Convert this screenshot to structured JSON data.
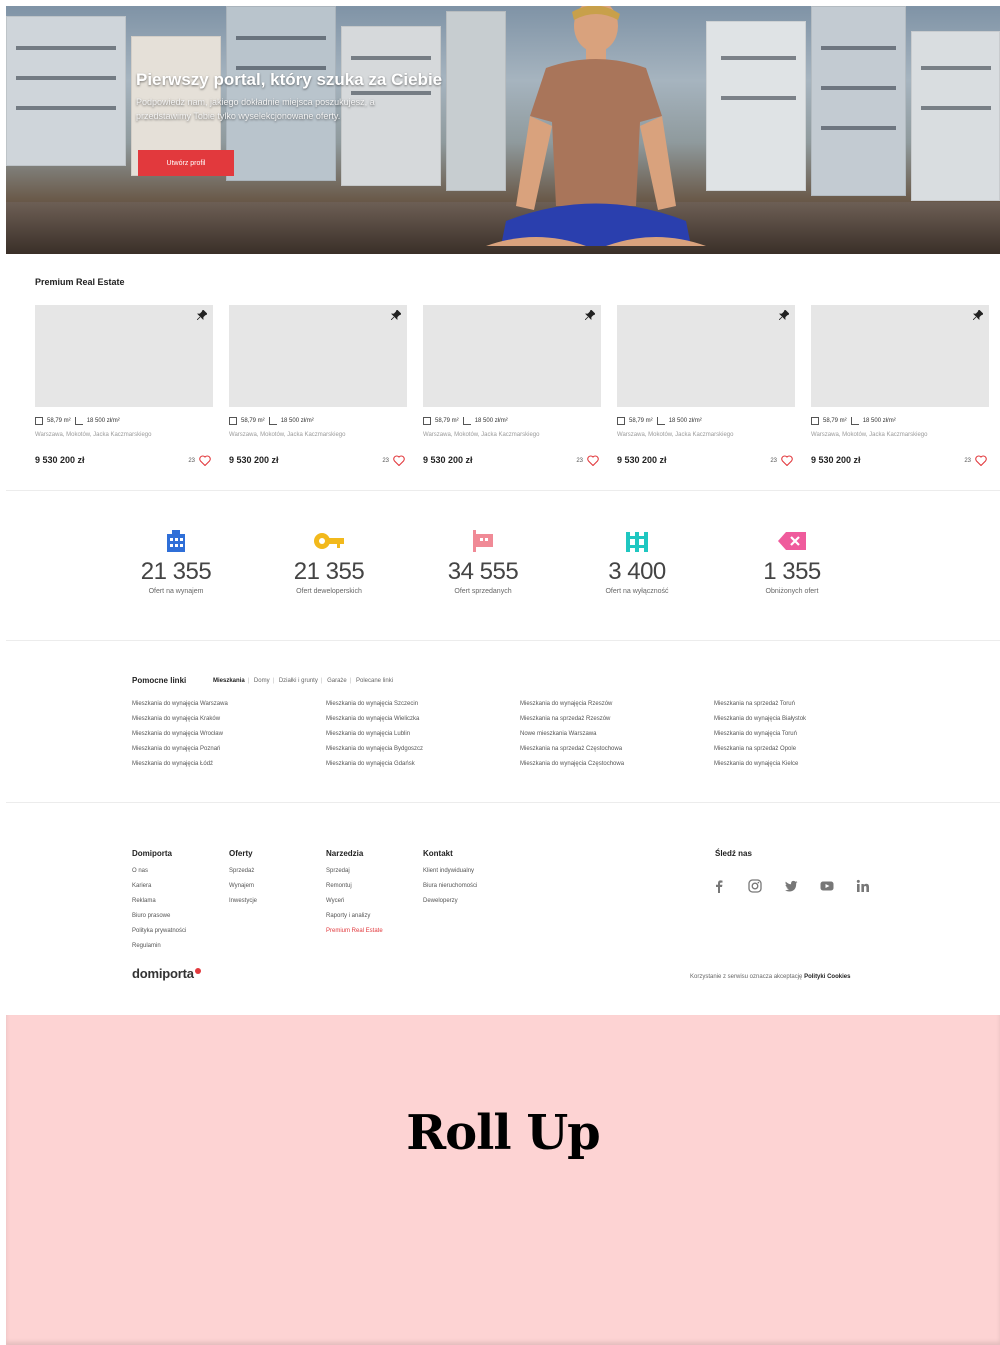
{
  "hero": {
    "title": "Pierwszy portal, który szuka za Ciebie",
    "subtitle": "Podpowiedz nam, jakiego dokładnie miejsca poszukujesz, a przedstawimy Tobie tylko wyselekcjonowane oferty.",
    "cta_label": "Utwórz profil"
  },
  "premium": {
    "title": "Premium Real Estate",
    "cards": [
      {
        "area": "58,79 m²",
        "price_per_m2": "18 500 zł/m²",
        "address": "Warszawa, Mokotów, Jacka Kaczmarskiego",
        "price": "9 530 200 zł",
        "likes": "23"
      },
      {
        "area": "58,79 m²",
        "price_per_m2": "18 500 zł/m²",
        "address": "Warszawa, Mokotów, Jacka Kaczmarskiego",
        "price": "9 530 200 zł",
        "likes": "23"
      },
      {
        "area": "58,79 m²",
        "price_per_m2": "18 500 zł/m²",
        "address": "Warszawa, Mokotów, Jacka Kaczmarskiego",
        "price": "9 530 200 zł",
        "likes": "23"
      },
      {
        "area": "58,79 m²",
        "price_per_m2": "18 500 zł/m²",
        "address": "Warszawa, Mokotów, Jacka Kaczmarskiego",
        "price": "9 530 200 zł",
        "likes": "23"
      },
      {
        "area": "58,79 m²",
        "price_per_m2": "18 500 zł/m²",
        "address": "Warszawa, Mokotów, Jacka Kaczmarskiego",
        "price": "9 530 200 zł",
        "likes": "23"
      }
    ]
  },
  "stats": [
    {
      "icon": "building-icon",
      "color": "#2f6fd8",
      "value": "21 355",
      "label": "Ofert na wynajem"
    },
    {
      "icon": "key-icon",
      "color": "#f2b91c",
      "value": "21 355",
      "label": "Ofert deweloperskich"
    },
    {
      "icon": "sign-icon",
      "color": "#f08a96",
      "value": "34 555",
      "label": "Ofert sprzedanych"
    },
    {
      "icon": "fence-icon",
      "color": "#1fc7c1",
      "value": "3 400",
      "label": "Ofert na wyłączność"
    },
    {
      "icon": "tag-icon",
      "color": "#ef5b9c",
      "value": "1 355",
      "label": "Obniżonych ofert"
    }
  ],
  "links": {
    "title": "Pomocne linki",
    "tabs": [
      "Mieszkania",
      "Domy",
      "Działki i grunty",
      "Garaże",
      "Polecane linki"
    ],
    "columns": [
      [
        "Mieszkania do wynajęcia Warszawa",
        "Mieszkania do wynajęcia Kraków",
        "Mieszkania do wynajęcia Wrocław",
        "Mieszkania do wynajęcia Poznań",
        "Mieszkania do wynajęcia Łódź"
      ],
      [
        "Mieszkania do wynajęcia Szczecin",
        "Mieszkania do wynajęcia Wieliczka",
        "Mieszkania do wynajęcia Lublin",
        "Mieszkania do wynajęcia Bydgoszcz",
        "Mieszkania do wynajęcia Gdańsk"
      ],
      [
        "Mieszkania do wynajęcia Rzeszów",
        "Mieszkania na sprzedaż Rzeszów",
        "Nowe mieszkania Warszawa",
        "Mieszkania na sprzedaż Częstochowa",
        "Mieszkania do wynajęcia Częstochowa"
      ],
      [
        "Mieszkania na sprzedaż Toruń",
        "Mieszkania do wynajęcia Białystok",
        "Mieszkania do wynajęcia Toruń",
        "Mieszkania na sprzedaż Opole",
        "Mieszkania do wynajęcia Kielce"
      ]
    ]
  },
  "footer": {
    "columns": [
      {
        "title": "Domiporta",
        "items": [
          "O nas",
          "Kariera",
          "Reklama",
          "Biuro prasowe",
          "Polityka prywatności",
          "Regulamin"
        ]
      },
      {
        "title": "Oferty",
        "items": [
          "Sprzedaż",
          "Wynajem",
          "Inwestycje"
        ]
      },
      {
        "title": "Narzedzia",
        "items": [
          "Sprzedaj",
          "Remontuj",
          "Wyceń",
          "Raporty i analizy",
          "Premium Real Estate"
        ]
      },
      {
        "title": "Kontakt",
        "items": [
          "Klient indywidualny",
          "Biura nieruchomości",
          "Deweloperzy"
        ]
      }
    ],
    "social_title": "Śledź nas",
    "social": [
      "facebook-icon",
      "instagram-icon",
      "twitter-icon",
      "youtube-icon",
      "linkedin-icon"
    ],
    "logo_text": "domiporta",
    "cookie_text": "Korzystanie z serwisu oznacza akceptację",
    "cookie_link": "Polityki Cookies"
  },
  "rollup": {
    "text": "Roll Up"
  },
  "colors": {
    "accent": "#e2393d",
    "rollup_bg": "#fdd3d3"
  }
}
